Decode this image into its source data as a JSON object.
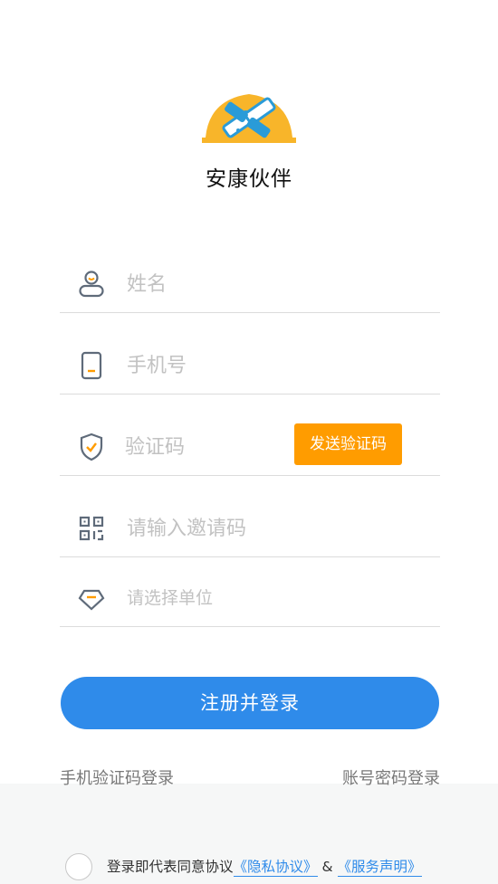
{
  "app": {
    "name": "安康伙伴",
    "logo_icon": "helmet-handshake-icon"
  },
  "form": {
    "name_placeholder": "姓名",
    "phone_placeholder": "手机号",
    "code_placeholder": "验证码",
    "send_code_label": "发送验证码",
    "invite_placeholder": "请输入邀请码",
    "unit_placeholder": "请选择单位"
  },
  "actions": {
    "register_label": "注册并登录",
    "sms_login_label": "手机验证码登录",
    "password_login_label": "账号密码登录"
  },
  "agreement": {
    "prefix": "登录即代表同意协议",
    "privacy": "《隐私协议》",
    "amp": "&",
    "service": "《服务声明》"
  },
  "colors": {
    "accent_blue": "#2f8bea",
    "accent_orange": "#ff9c00",
    "icon_gray": "#5f6b7a"
  }
}
